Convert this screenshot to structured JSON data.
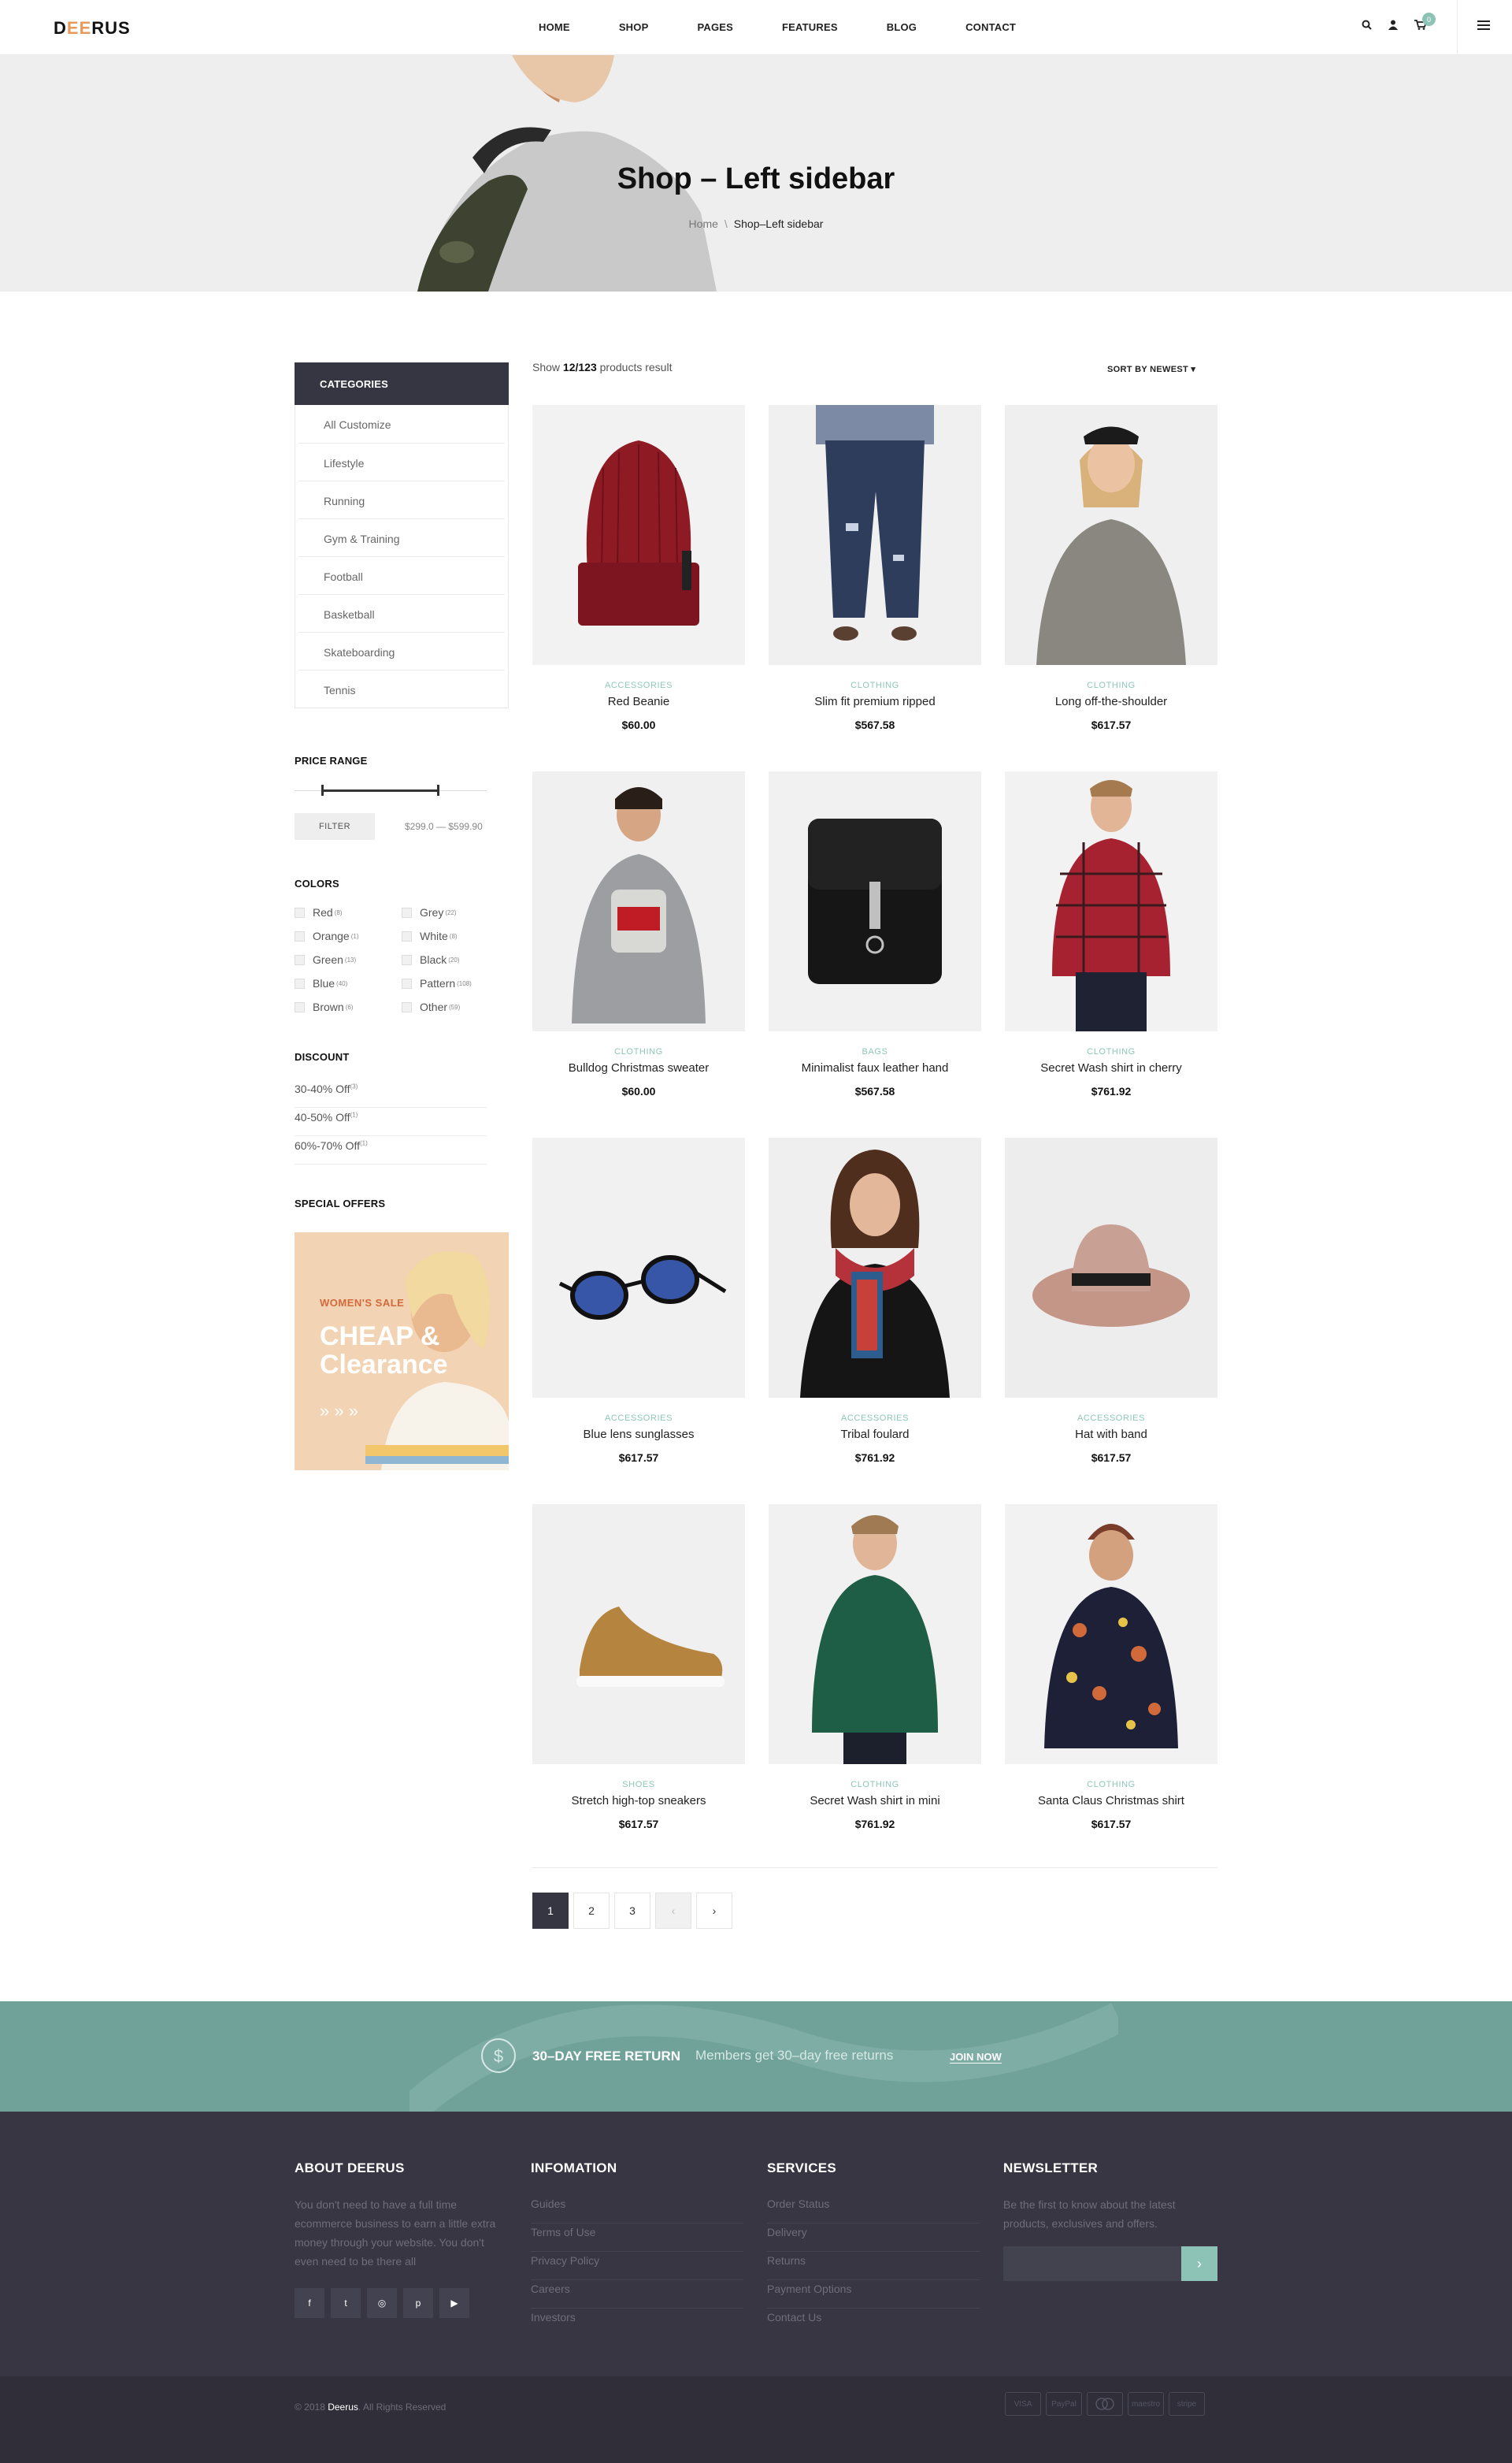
{
  "brand": {
    "name_pre": "D",
    "name_accent": "EE",
    "name_post": "RUS",
    "accent_color": "#e79a5c"
  },
  "nav": {
    "items": [
      "HOME",
      "SHOP",
      "PAGES",
      "FEATURES",
      "BLOG",
      "CONTACT"
    ]
  },
  "header": {
    "cart_count": "0",
    "icons": [
      "search-icon",
      "user-icon",
      "cart-icon",
      "menu-icon"
    ]
  },
  "hero": {
    "title": "Shop – Left sidebar",
    "breadcrumb_home": "Home",
    "breadcrumb_sep": "\\",
    "breadcrumb_current": "Shop–Left sidebar"
  },
  "sidebar": {
    "categories_title": "CATEGORIES",
    "categories": [
      "All Customize",
      "Lifestyle",
      "Running",
      "Gym & Training",
      "Football",
      "Basketball",
      "Skateboarding",
      "Tennis"
    ],
    "price_title": "PRICE RANGE",
    "filter_label": "FILTER",
    "price_range_text": "$299.0 — $599.90",
    "colors_title": "COLORS",
    "colors": [
      {
        "name": "Red",
        "count": "(8)"
      },
      {
        "name": "Grey",
        "count": "(22)"
      },
      {
        "name": "Orange",
        "count": "(1)"
      },
      {
        "name": "White",
        "count": "(8)"
      },
      {
        "name": "Green",
        "count": "(13)"
      },
      {
        "name": "Black",
        "count": "(20)"
      },
      {
        "name": "Blue",
        "count": "(40)"
      },
      {
        "name": "Pattern",
        "count": "(108)"
      },
      {
        "name": "Brown",
        "count": "(6)"
      },
      {
        "name": "Other",
        "count": "(59)"
      }
    ],
    "discount_title": "DISCOUNT",
    "discounts": [
      {
        "label": "30-40% Off",
        "count": "(3)"
      },
      {
        "label": "40-50% Off",
        "count": "(1)"
      },
      {
        "label": "60%-70% Off",
        "count": "(1)"
      }
    ],
    "offers_title": "SPECIAL OFFERS",
    "offer_subtitle": "WOMEN'S SALE",
    "offer_title": "CHEAP & Clearance"
  },
  "toolbar": {
    "result_pre": "Show ",
    "result_count": "12/123",
    "result_post": " products result",
    "sort_label": "SORT BY NEWEST"
  },
  "products": [
    {
      "category": "ACCESSORIES",
      "name": "Red Beanie",
      "price": "$60.00",
      "bg": "#f2f2f2"
    },
    {
      "category": "CLOTHING",
      "name": "Slim fit premium ripped",
      "price": "$567.58",
      "bg": "#f0f0f0"
    },
    {
      "category": "CLOTHING",
      "name": "Long off-the-shoulder",
      "price": "$617.57",
      "bg": "#efefef"
    },
    {
      "category": "CLOTHING",
      "name": "Bulldog Christmas sweater",
      "price": "$60.00",
      "bg": "#f0f0f0"
    },
    {
      "category": "BAGS",
      "name": "Minimalist faux leather hand",
      "price": "$567.58",
      "bg": "#f1f1f1"
    },
    {
      "category": "CLOTHING",
      "name": "Secret Wash shirt in cherry",
      "price": "$761.92",
      "bg": "#f2f2f2"
    },
    {
      "category": "ACCESSORIES",
      "name": "Blue lens sunglasses",
      "price": "$617.57",
      "bg": "#f1f1f1"
    },
    {
      "category": "ACCESSORIES",
      "name": "Tribal foulard",
      "price": "$761.92",
      "bg": "#efefef"
    },
    {
      "category": "ACCESSORIES",
      "name": "Hat with band",
      "price": "$617.57",
      "bg": "#ededed"
    },
    {
      "category": "SHOES",
      "name": "Stretch high-top sneakers",
      "price": "$617.57",
      "bg": "#f0f0f0"
    },
    {
      "category": "CLOTHING",
      "name": "Secret Wash shirt in mini",
      "price": "$761.92",
      "bg": "#f1f1f1"
    },
    {
      "category": "CLOTHING",
      "name": "Santa Claus Christmas shirt",
      "price": "$617.57",
      "bg": "#f2f2f2"
    }
  ],
  "pagination": {
    "pages": [
      "1",
      "2",
      "3"
    ],
    "prev": "‹",
    "next": "›",
    "active": "1"
  },
  "promo": {
    "title": "30–DAY FREE RETURN",
    "text": "Members get 30–day free returns",
    "link": "JOIN NOW"
  },
  "footer": {
    "about_title": "ABOUT DEERUS",
    "about_text": "You don't need to have a full time ecommerce business to earn a little extra money through your website. You don't even need to be there all",
    "info_title": "INFOMATION",
    "info_links": [
      "Guides",
      "Terms of Use",
      "Privacy Policy",
      "Careers",
      "Investors"
    ],
    "services_title": "SERVICES",
    "services_links": [
      "Order Status",
      "Delivery",
      "Returns",
      "Payment Options",
      "Contact Us"
    ],
    "newsletter_title": "NEWSLETTER",
    "newsletter_text": "Be the first to know about the latest products, exclusives and offers.",
    "newsletter_btn": "›",
    "socials": [
      "f",
      "t",
      "◎",
      "p",
      "▶"
    ],
    "copyright_pre": "© 2018 ",
    "copyright_brand": "Deerus",
    "copyright_post": ". All Rights Reserved",
    "payments": [
      "VISA",
      "PayPal",
      "",
      "maestro",
      "stripe"
    ]
  }
}
